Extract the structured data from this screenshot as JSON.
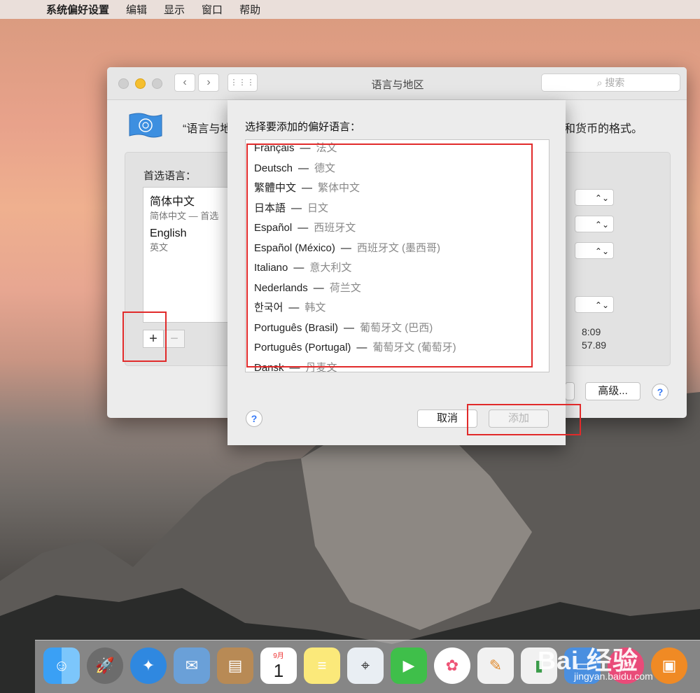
{
  "menubar": {
    "app_name": "系统偏好设置",
    "items": [
      "编辑",
      "显示",
      "窗口",
      "帮助"
    ]
  },
  "window": {
    "title": "语言与地区",
    "search_placeholder": "搜索",
    "description_left": "“语言与地",
    "description_right": "和货币的格式。",
    "preferred_label": "首选语言：",
    "languages": [
      {
        "name": "简体中文",
        "sub": "简体中文 — 首选"
      },
      {
        "name": "English",
        "sub": "英文"
      }
    ],
    "add_symbol": "+",
    "remove_symbol": "−",
    "time_partial_1": "8:09",
    "time_partial_2": "57.89",
    "advanced_label": "高级...",
    "help_label": "?"
  },
  "sheet": {
    "title": "选择要添加的偏好语言：",
    "items": [
      {
        "name": "Français",
        "translation": "法文"
      },
      {
        "name": "Deutsch",
        "translation": "德文"
      },
      {
        "name": "繁體中文",
        "translation": "繁体中文"
      },
      {
        "name": "日本語",
        "translation": "日文"
      },
      {
        "name": "Español",
        "translation": "西班牙文"
      },
      {
        "name": "Español (México)",
        "translation": "西班牙文 (墨西哥)"
      },
      {
        "name": "Italiano",
        "translation": "意大利文"
      },
      {
        "name": "Nederlands",
        "translation": "荷兰文"
      },
      {
        "name": "한국어",
        "translation": "韩文"
      },
      {
        "name": "Português (Brasil)",
        "translation": "葡萄牙文 (巴西)"
      },
      {
        "name": "Português (Portugal)",
        "translation": "葡萄牙文 (葡萄牙)"
      },
      {
        "name": "Dansk",
        "translation": "丹麦文"
      }
    ],
    "dash": "—",
    "help_label": "?",
    "cancel_label": "取消",
    "add_label": "添加"
  },
  "dock": {
    "calendar_month": "9月",
    "calendar_day": "1"
  },
  "watermark": {
    "brand": "Bai 经验",
    "url": "jingyan.baidu.com"
  },
  "colors": {
    "highlight_red": "#e12a2a",
    "help_blue": "#3478f6"
  }
}
